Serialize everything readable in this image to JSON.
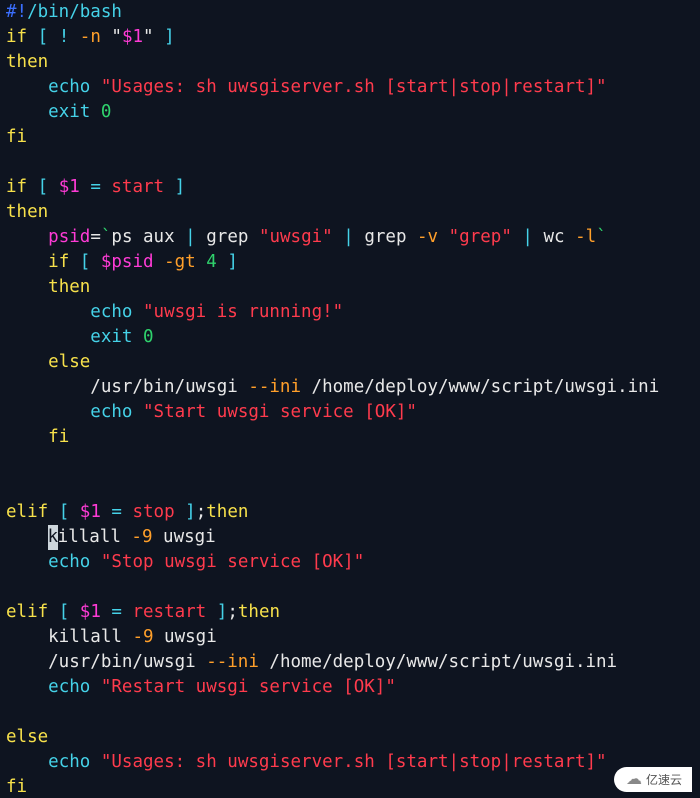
{
  "code": {
    "l1": [
      {
        "t": "#!",
        "c": "bl"
      },
      {
        "t": "/bin/bash",
        "c": "cy"
      }
    ],
    "l2": [
      {
        "t": "if",
        "c": "ye"
      },
      {
        "t": " ",
        "c": "wh"
      },
      {
        "t": "[ ",
        "c": "cy"
      },
      {
        "t": "! ",
        "c": "cy"
      },
      {
        "t": "-n",
        "c": "or"
      },
      {
        "t": " \"",
        "c": "wh"
      },
      {
        "t": "$1",
        "c": "mg"
      },
      {
        "t": "\" ",
        "c": "wh"
      },
      {
        "t": "]",
        "c": "cy"
      }
    ],
    "l3": [
      {
        "t": "then",
        "c": "ye"
      }
    ],
    "l4": [
      {
        "t": "    ",
        "c": "wh"
      },
      {
        "t": "echo",
        "c": "cy"
      },
      {
        "t": " ",
        "c": "wh"
      },
      {
        "t": "\"Usages: sh uwsgiserver.sh [start|stop|restart]\"",
        "c": "rd"
      }
    ],
    "l5": [
      {
        "t": "    ",
        "c": "wh"
      },
      {
        "t": "exit",
        "c": "cy"
      },
      {
        "t": " ",
        "c": "wh"
      },
      {
        "t": "0",
        "c": "gr"
      }
    ],
    "l6": [
      {
        "t": "fi",
        "c": "ye"
      }
    ],
    "l7": [
      {
        "t": "",
        "c": "wh"
      }
    ],
    "l8": [
      {
        "t": "if",
        "c": "ye"
      },
      {
        "t": " ",
        "c": "wh"
      },
      {
        "t": "[ ",
        "c": "cy"
      },
      {
        "t": "$1",
        "c": "mg"
      },
      {
        "t": " = ",
        "c": "cy"
      },
      {
        "t": "start",
        "c": "rd"
      },
      {
        "t": " ",
        "c": "wh"
      },
      {
        "t": "]",
        "c": "cy"
      }
    ],
    "l9": [
      {
        "t": "then",
        "c": "ye"
      }
    ],
    "l10": [
      {
        "t": "    ",
        "c": "wh"
      },
      {
        "t": "psid",
        "c": "mg"
      },
      {
        "t": "=",
        "c": "wh"
      },
      {
        "t": "`",
        "c": "gr"
      },
      {
        "t": "ps aux ",
        "c": "wh"
      },
      {
        "t": "|",
        "c": "cy"
      },
      {
        "t": " grep ",
        "c": "wh"
      },
      {
        "t": "\"uwsgi\"",
        "c": "rd"
      },
      {
        "t": " ",
        "c": "wh"
      },
      {
        "t": "|",
        "c": "cy"
      },
      {
        "t": " grep ",
        "c": "wh"
      },
      {
        "t": "-v",
        "c": "or"
      },
      {
        "t": " ",
        "c": "wh"
      },
      {
        "t": "\"grep\"",
        "c": "rd"
      },
      {
        "t": " ",
        "c": "wh"
      },
      {
        "t": "|",
        "c": "cy"
      },
      {
        "t": " wc ",
        "c": "wh"
      },
      {
        "t": "-l",
        "c": "or"
      },
      {
        "t": "`",
        "c": "gr"
      }
    ],
    "l11": [
      {
        "t": "    ",
        "c": "wh"
      },
      {
        "t": "if",
        "c": "ye"
      },
      {
        "t": " ",
        "c": "wh"
      },
      {
        "t": "[ ",
        "c": "cy"
      },
      {
        "t": "$psid",
        "c": "mg"
      },
      {
        "t": " ",
        "c": "wh"
      },
      {
        "t": "-gt",
        "c": "or"
      },
      {
        "t": " ",
        "c": "wh"
      },
      {
        "t": "4",
        "c": "gr"
      },
      {
        "t": " ",
        "c": "wh"
      },
      {
        "t": "]",
        "c": "cy"
      }
    ],
    "l12": [
      {
        "t": "    ",
        "c": "wh"
      },
      {
        "t": "then",
        "c": "ye"
      }
    ],
    "l13": [
      {
        "t": "        ",
        "c": "wh"
      },
      {
        "t": "echo",
        "c": "cy"
      },
      {
        "t": " ",
        "c": "wh"
      },
      {
        "t": "\"uwsgi is running!\"",
        "c": "rd"
      }
    ],
    "l14": [
      {
        "t": "        ",
        "c": "wh"
      },
      {
        "t": "exit",
        "c": "cy"
      },
      {
        "t": " ",
        "c": "wh"
      },
      {
        "t": "0",
        "c": "gr"
      }
    ],
    "l15": [
      {
        "t": "    ",
        "c": "wh"
      },
      {
        "t": "else",
        "c": "ye"
      }
    ],
    "l16": [
      {
        "t": "        /usr/bin/uwsgi ",
        "c": "wh"
      },
      {
        "t": "--ini",
        "c": "or"
      },
      {
        "t": " /home/deploy/www/script/uwsgi.ini",
        "c": "wh"
      }
    ],
    "l17": [
      {
        "t": "        ",
        "c": "wh"
      },
      {
        "t": "echo",
        "c": "cy"
      },
      {
        "t": " ",
        "c": "wh"
      },
      {
        "t": "\"Start uwsgi service [OK]\"",
        "c": "rd"
      }
    ],
    "l18": [
      {
        "t": "    ",
        "c": "wh"
      },
      {
        "t": "fi",
        "c": "ye"
      }
    ],
    "l19": [
      {
        "t": "",
        "c": "wh"
      }
    ],
    "l20": [
      {
        "t": "",
        "c": "wh"
      }
    ],
    "l21": [
      {
        "t": "elif",
        "c": "ye"
      },
      {
        "t": " ",
        "c": "wh"
      },
      {
        "t": "[ ",
        "c": "cy"
      },
      {
        "t": "$1",
        "c": "mg"
      },
      {
        "t": " = ",
        "c": "cy"
      },
      {
        "t": "stop",
        "c": "rd"
      },
      {
        "t": " ",
        "c": "wh"
      },
      {
        "t": "]",
        "c": "cy"
      },
      {
        "t": ";",
        "c": "wh"
      },
      {
        "t": "then",
        "c": "ye"
      }
    ],
    "l22": [
      {
        "t": "    ",
        "c": "wh"
      },
      {
        "t": "k",
        "c": "cursor"
      },
      {
        "t": "illall ",
        "c": "wh"
      },
      {
        "t": "-9",
        "c": "or"
      },
      {
        "t": " uwsgi",
        "c": "wh"
      }
    ],
    "l23": [
      {
        "t": "    ",
        "c": "wh"
      },
      {
        "t": "echo",
        "c": "cy"
      },
      {
        "t": " ",
        "c": "wh"
      },
      {
        "t": "\"Stop uwsgi service [OK]\"",
        "c": "rd"
      }
    ],
    "l24": [
      {
        "t": "",
        "c": "wh"
      }
    ],
    "l25": [
      {
        "t": "elif",
        "c": "ye"
      },
      {
        "t": " ",
        "c": "wh"
      },
      {
        "t": "[ ",
        "c": "cy"
      },
      {
        "t": "$1",
        "c": "mg"
      },
      {
        "t": " = ",
        "c": "cy"
      },
      {
        "t": "restart",
        "c": "rd"
      },
      {
        "t": " ",
        "c": "wh"
      },
      {
        "t": "]",
        "c": "cy"
      },
      {
        "t": ";",
        "c": "wh"
      },
      {
        "t": "then",
        "c": "ye"
      }
    ],
    "l26": [
      {
        "t": "    killall ",
        "c": "wh"
      },
      {
        "t": "-9",
        "c": "or"
      },
      {
        "t": " uwsgi",
        "c": "wh"
      }
    ],
    "l27": [
      {
        "t": "    /usr/bin/uwsgi ",
        "c": "wh"
      },
      {
        "t": "--ini",
        "c": "or"
      },
      {
        "t": " /home/deploy/www/script/uwsgi.ini",
        "c": "wh"
      }
    ],
    "l28": [
      {
        "t": "    ",
        "c": "wh"
      },
      {
        "t": "echo",
        "c": "cy"
      },
      {
        "t": " ",
        "c": "wh"
      },
      {
        "t": "\"Restart uwsgi service [OK]\"",
        "c": "rd"
      }
    ],
    "l29": [
      {
        "t": "",
        "c": "wh"
      }
    ],
    "l30": [
      {
        "t": "else",
        "c": "ye"
      }
    ],
    "l31": [
      {
        "t": "    ",
        "c": "wh"
      },
      {
        "t": "echo",
        "c": "cy"
      },
      {
        "t": " ",
        "c": "wh"
      },
      {
        "t": "\"Usages: sh uwsgiserver.sh [start|stop|restart]\"",
        "c": "rd"
      }
    ],
    "l32": [
      {
        "t": "fi",
        "c": "ye"
      }
    ]
  },
  "watermark": "亿速云"
}
